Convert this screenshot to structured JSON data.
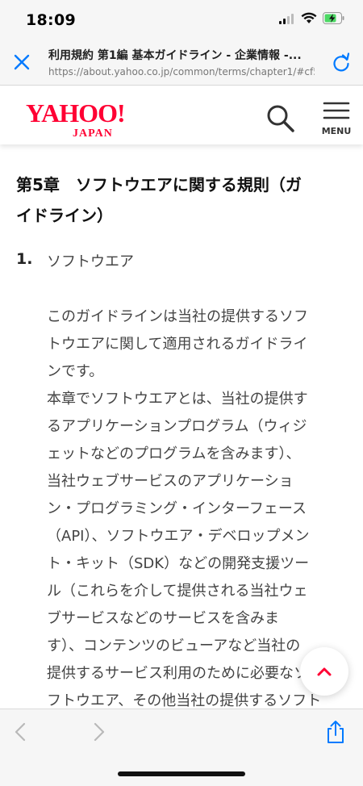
{
  "status_bar": {
    "time": "18:09"
  },
  "browser": {
    "title": "利用規約 第1編 基本ガイドライン - 企業情報 -...",
    "url": "https://about.yahoo.co.jp/common/terms/chapter1/#cf5th",
    "icons": {
      "close": "close-icon",
      "reload": "reload-icon"
    }
  },
  "site": {
    "logo_text": "YAHOO!",
    "logo_subtext": "JAPAN",
    "menu_label": "MENU",
    "colors": {
      "brand": "#ff0033",
      "accent": "#007aff"
    }
  },
  "content": {
    "chapter_heading_line1": "第5章　ソフトウエアに関する規則（ガ",
    "chapter_heading_line2": "イドライン）",
    "section_number": "1.",
    "section_title": "ソフトウエア",
    "body_lines": [
      "このガイドラインは当社の提供するソフ",
      "トウエアに関して適用されるガイドライ",
      "ンです。",
      "本章でソフトウエアとは、当社の提供す",
      "るアプリケーションプログラム（ウィジ",
      "ェットなどのプログラムを含みます）、",
      "当社ウェブサービスのアプリケーショ",
      "ン・プログラミング・インターフェース",
      "（API）、ソフトウエア・デベロップメン",
      "ト・キット（SDK）などの開発支援ツー",
      "ル（これらを介して提供される当社ウェ",
      "ブサービスなどのサービスを含みま",
      "す）、コンテンツのビューアなど当社の",
      "提供するサービス利用のために必要なソ",
      "フトウエア、その他当社の提供するソフト"
    ]
  }
}
